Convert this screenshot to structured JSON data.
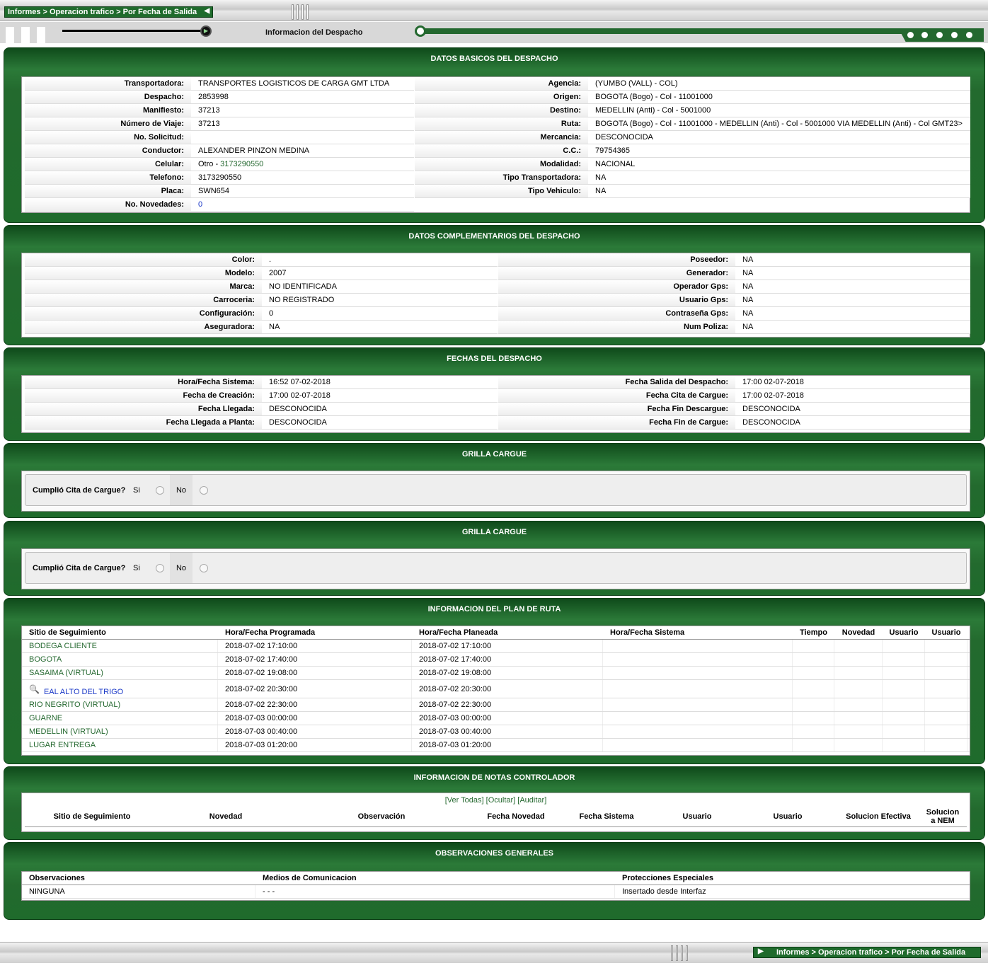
{
  "header": {
    "breadcrumb": "Informes > Operacion trafico > Por Fecha de Salida",
    "subtitle": "Informacion del Despacho"
  },
  "basicos": {
    "title": "DATOS BASICOS DEL DESPACHO",
    "left": [
      {
        "label": "Transportadora:",
        "value": "TRANSPORTES LOGISTICOS DE CARGA GMT LTDA"
      },
      {
        "label": "Despacho:",
        "value": "2853998"
      },
      {
        "label": "Manifiesto:",
        "value": "37213"
      },
      {
        "label": "Número de Viaje:",
        "value": "37213"
      },
      {
        "label": "No. Solicitud:",
        "value": ""
      },
      {
        "label": "Conductor:",
        "value": "ALEXANDER PINZON MEDINA"
      },
      {
        "label": "Celular:",
        "value": "Otro - ",
        "value2": "3173290550"
      },
      {
        "label": "Telefono:",
        "value": "3173290550"
      },
      {
        "label": "Placa:",
        "value": "SWN654"
      },
      {
        "label": "No. Novedades:",
        "value": "0"
      }
    ],
    "right": [
      {
        "label": "Agencia:",
        "value": "(YUMBO (VALL) - COL)"
      },
      {
        "label": "Origen:",
        "value": "BOGOTA (Bogo) - Col - 11001000"
      },
      {
        "label": "Destino:",
        "value": "MEDELLIN (Anti) - Col - 5001000"
      },
      {
        "label": "Ruta:",
        "value": "BOGOTA (Bogo) - Col - 11001000 - MEDELLIN (Anti) - Col - 5001000 VIA MEDELLIN (Anti) - Col GMT23>"
      },
      {
        "label": "Mercancia:",
        "value": "DESCONOCIDA"
      },
      {
        "label": "C.C.:",
        "value": "79754365"
      },
      {
        "label": "Modalidad:",
        "value": "NACIONAL"
      },
      {
        "label": "Tipo Transportadora:",
        "value": "NA"
      },
      {
        "label": "Tipo Vehiculo:",
        "value": "NA"
      }
    ]
  },
  "complementarios": {
    "title": "DATOS COMPLEMENTARIOS DEL DESPACHO",
    "left": [
      {
        "label": "Color:",
        "value": "."
      },
      {
        "label": "Modelo:",
        "value": "2007"
      },
      {
        "label": "Marca:",
        "value": "NO IDENTIFICADA"
      },
      {
        "label": "Carroceria:",
        "value": "NO REGISTRADO"
      },
      {
        "label": "Configuración:",
        "value": "0"
      },
      {
        "label": "Aseguradora:",
        "value": "NA"
      }
    ],
    "right": [
      {
        "label": "Poseedor:",
        "value": "NA"
      },
      {
        "label": "Generador:",
        "value": "NA"
      },
      {
        "label": "Operador Gps:",
        "value": "NA"
      },
      {
        "label": "Usuario Gps:",
        "value": "NA"
      },
      {
        "label": "Contraseña Gps:",
        "value": "NA"
      },
      {
        "label": "Num Poliza:",
        "value": "NA"
      }
    ]
  },
  "fechas": {
    "title": "FECHAS DEL DESPACHO",
    "left": [
      {
        "label": "Hora/Fecha Sistema:",
        "value": "16:52 07-02-2018"
      },
      {
        "label": "Fecha de Creación:",
        "value": "17:00 02-07-2018"
      },
      {
        "label": "Fecha Llegada:",
        "value": "DESCONOCIDA"
      },
      {
        "label": "Fecha Llegada a Planta:",
        "value": "DESCONOCIDA"
      }
    ],
    "right": [
      {
        "label": "Fecha Salida del Despacho:",
        "value": "17:00 02-07-2018"
      },
      {
        "label": "Fecha Cita de Cargue:",
        "value": "17:00 02-07-2018"
      },
      {
        "label": "Fecha Fin Descargue:",
        "value": "DESCONOCIDA"
      },
      {
        "label": "Fecha Fin de Cargue:",
        "value": "DESCONOCIDA"
      }
    ]
  },
  "grilla": {
    "title": "GRILLA CARGUE",
    "question": "Cumplió Cita de Cargue?",
    "si": "Si",
    "no": "No"
  },
  "plan": {
    "title": "INFORMACION DEL PLAN DE RUTA",
    "headers": [
      "Sitio de Seguimiento",
      "Hora/Fecha Programada",
      "Hora/Fecha Planeada",
      "Hora/Fecha Sistema",
      "Tiempo",
      "Novedad",
      "Usuario",
      "Usuario"
    ],
    "rows": [
      [
        "BODEGA CLIENTE",
        "2018-07-02 17:10:00",
        "2018-07-02 17:10:00"
      ],
      [
        "BOGOTA",
        "2018-07-02 17:40:00",
        "2018-07-02 17:40:00"
      ],
      [
        "SASAIMA (VIRTUAL)",
        "2018-07-02 19:08:00",
        "2018-07-02 19:08:00"
      ],
      [
        "EAL ALTO DEL TRIGO",
        "2018-07-02 20:30:00",
        "2018-07-02 20:30:00"
      ],
      [
        "RIO NEGRITO (VIRTUAL)",
        "2018-07-02 22:30:00",
        "2018-07-02 22:30:00"
      ],
      [
        "GUARNE",
        "2018-07-03 00:00:00",
        "2018-07-03 00:00:00"
      ],
      [
        "MEDELLIN (VIRTUAL)",
        "2018-07-03 00:40:00",
        "2018-07-03 00:40:00"
      ],
      [
        "LUGAR ENTREGA",
        "2018-07-03 01:20:00",
        "2018-07-03 01:20:00"
      ]
    ]
  },
  "notas": {
    "title": "INFORMACION DE NOTAS CONTROLADOR",
    "links": [
      "[Ver Todas]",
      "[Ocultar]",
      "[Auditar]"
    ],
    "headers": [
      "Sitio de Seguimiento",
      "Novedad",
      "Observación",
      "Fecha Novedad",
      "Fecha Sistema",
      "Usuario",
      "Usuario",
      "Solucion Efectiva",
      "Solucion a NEM"
    ]
  },
  "observaciones": {
    "title": "OBSERVACIONES GENERALES",
    "headers": [
      "Observaciones",
      "Medios de Comunicacion",
      "Protecciones Especiales"
    ],
    "values": [
      "NINGUNA",
      "- - -",
      "Insertado desde Interfaz"
    ]
  },
  "colors": {
    "panel_green": "#1f6b2c",
    "link_green": "#24682f",
    "link_blue": "#1a38c7"
  }
}
